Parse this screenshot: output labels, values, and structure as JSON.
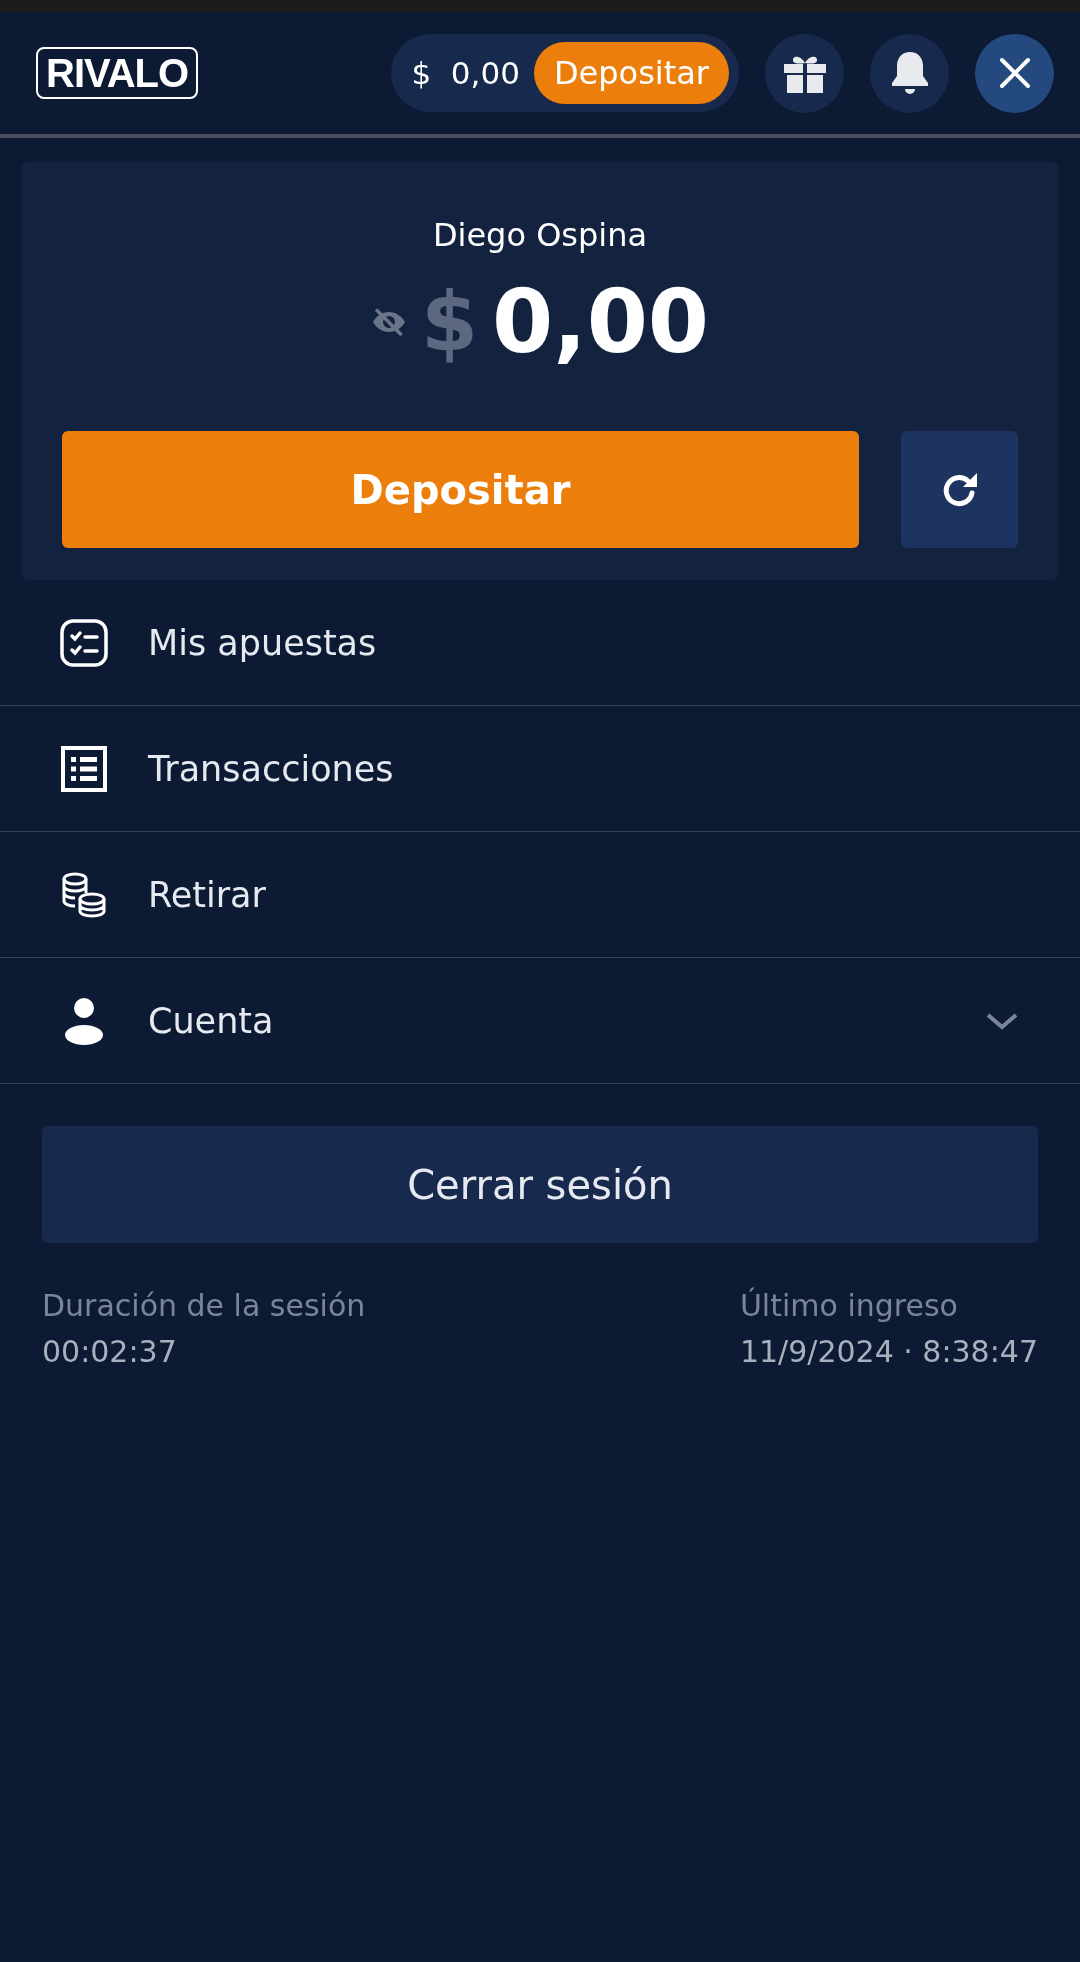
{
  "header": {
    "logo": "RIVALO",
    "currency": "$",
    "balance": "0,00",
    "deposit_label": "Depositar"
  },
  "account": {
    "name": "Diego Ospina",
    "currency": "$",
    "balance": "0,00",
    "deposit_label": "Depositar"
  },
  "menu": [
    {
      "kind": "link",
      "label": "Mis apuestas"
    },
    {
      "kind": "link",
      "label": "Transacciones"
    },
    {
      "kind": "link",
      "label": "Retirar"
    },
    {
      "kind": "expandable",
      "label": "Cuenta",
      "expanded": false
    }
  ],
  "logout_label": "Cerrar sesión",
  "session": {
    "duration_label": "Duración de la sesión",
    "duration": "00:02:37",
    "last_login_label": "Último ingreso",
    "last_login": "11/9/2024 · 8:38:47"
  }
}
